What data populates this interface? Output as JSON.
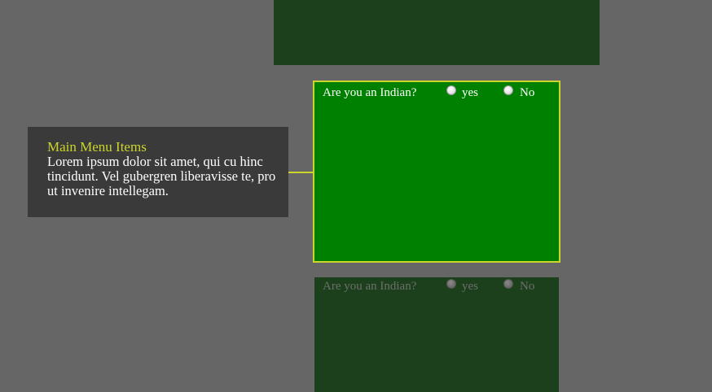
{
  "question_cards": [
    {
      "question": "Are you an Indian?",
      "options": [
        {
          "label": "yes"
        },
        {
          "label": "No"
        }
      ],
      "state": "highlighted"
    },
    {
      "question": "Are you an Indian?",
      "options": [
        {
          "label": "yes"
        },
        {
          "label": "No"
        }
      ],
      "state": "dimmed"
    }
  ],
  "tooltip": {
    "title": "Main Menu Items",
    "body": "Lorem ipsum dolor sit amet, qui cu hinc tincidunt. Vel gubergren liberavisse te, pro ut invenire intellegam."
  },
  "colors": {
    "page_background": "#666666",
    "dim_panel": "#1b401b",
    "active_card": "#008000",
    "highlight_accent": "#cbd52a",
    "tooltip_background": "#3a3a3a"
  }
}
